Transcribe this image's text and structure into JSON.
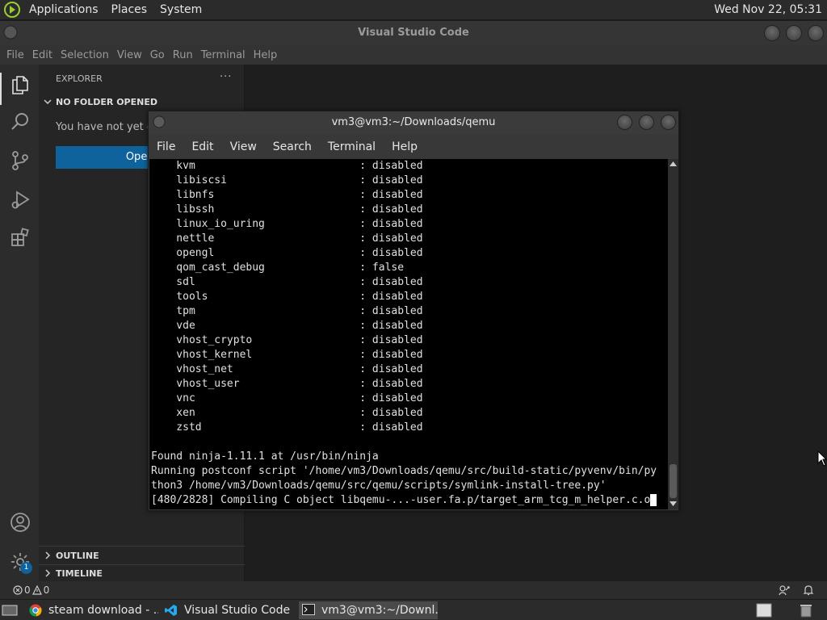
{
  "top_panel": {
    "menus": [
      "Applications",
      "Places",
      "System"
    ],
    "clock": "Wed Nov 22, 05:31"
  },
  "vscode": {
    "title": "Visual Studio Code",
    "menus": [
      "File",
      "Edit",
      "Selection",
      "View",
      "Go",
      "Run",
      "Terminal",
      "Help"
    ],
    "explorer_title": "EXPLORER",
    "explorer_more": "···",
    "no_folder_header": "NO FOLDER OPENED",
    "no_folder_text": "You have not yet op",
    "open_folder_button": "Open F",
    "outline": "OUTLINE",
    "timeline": "TIMELINE",
    "settings_badge": "1",
    "status_errors": "0",
    "status_warnings": "0",
    "accent_color": "#0e639c"
  },
  "terminal": {
    "title": "vm3@vm3:~/Downloads/qemu",
    "menus": [
      "File",
      "Edit",
      "View",
      "Search",
      "Terminal",
      "Help"
    ],
    "lines": [
      "    kvm                          : disabled",
      "    libiscsi                     : disabled",
      "    libnfs                       : disabled",
      "    libssh                       : disabled",
      "    linux_io_uring               : disabled",
      "    nettle                       : disabled",
      "    opengl                       : disabled",
      "    qom_cast_debug               : false",
      "    sdl                          : disabled",
      "    tools                        : disabled",
      "    tpm                          : disabled",
      "    vde                          : disabled",
      "    vhost_crypto                 : disabled",
      "    vhost_kernel                 : disabled",
      "    vhost_net                    : disabled",
      "    vhost_user                   : disabled",
      "    vnc                          : disabled",
      "    xen                          : disabled",
      "    zstd                         : disabled",
      "",
      "Found ninja-1.11.1 at /usr/bin/ninja",
      "Running postconf script '/home/vm3/Downloads/qemu/src/build-static/pyvenv/bin/py",
      "thon3 /home/vm3/Downloads/qemu/src/qemu/scripts/symlink-install-tree.py'",
      "[480/2828] Compiling C object libqemu-...-user.fa.p/target_arm_tcg_m_helper.c.o"
    ]
  },
  "taskbar": {
    "items": [
      "steam download - ...",
      "Visual Studio Code",
      "vm3@vm3:~/Downl..."
    ]
  }
}
